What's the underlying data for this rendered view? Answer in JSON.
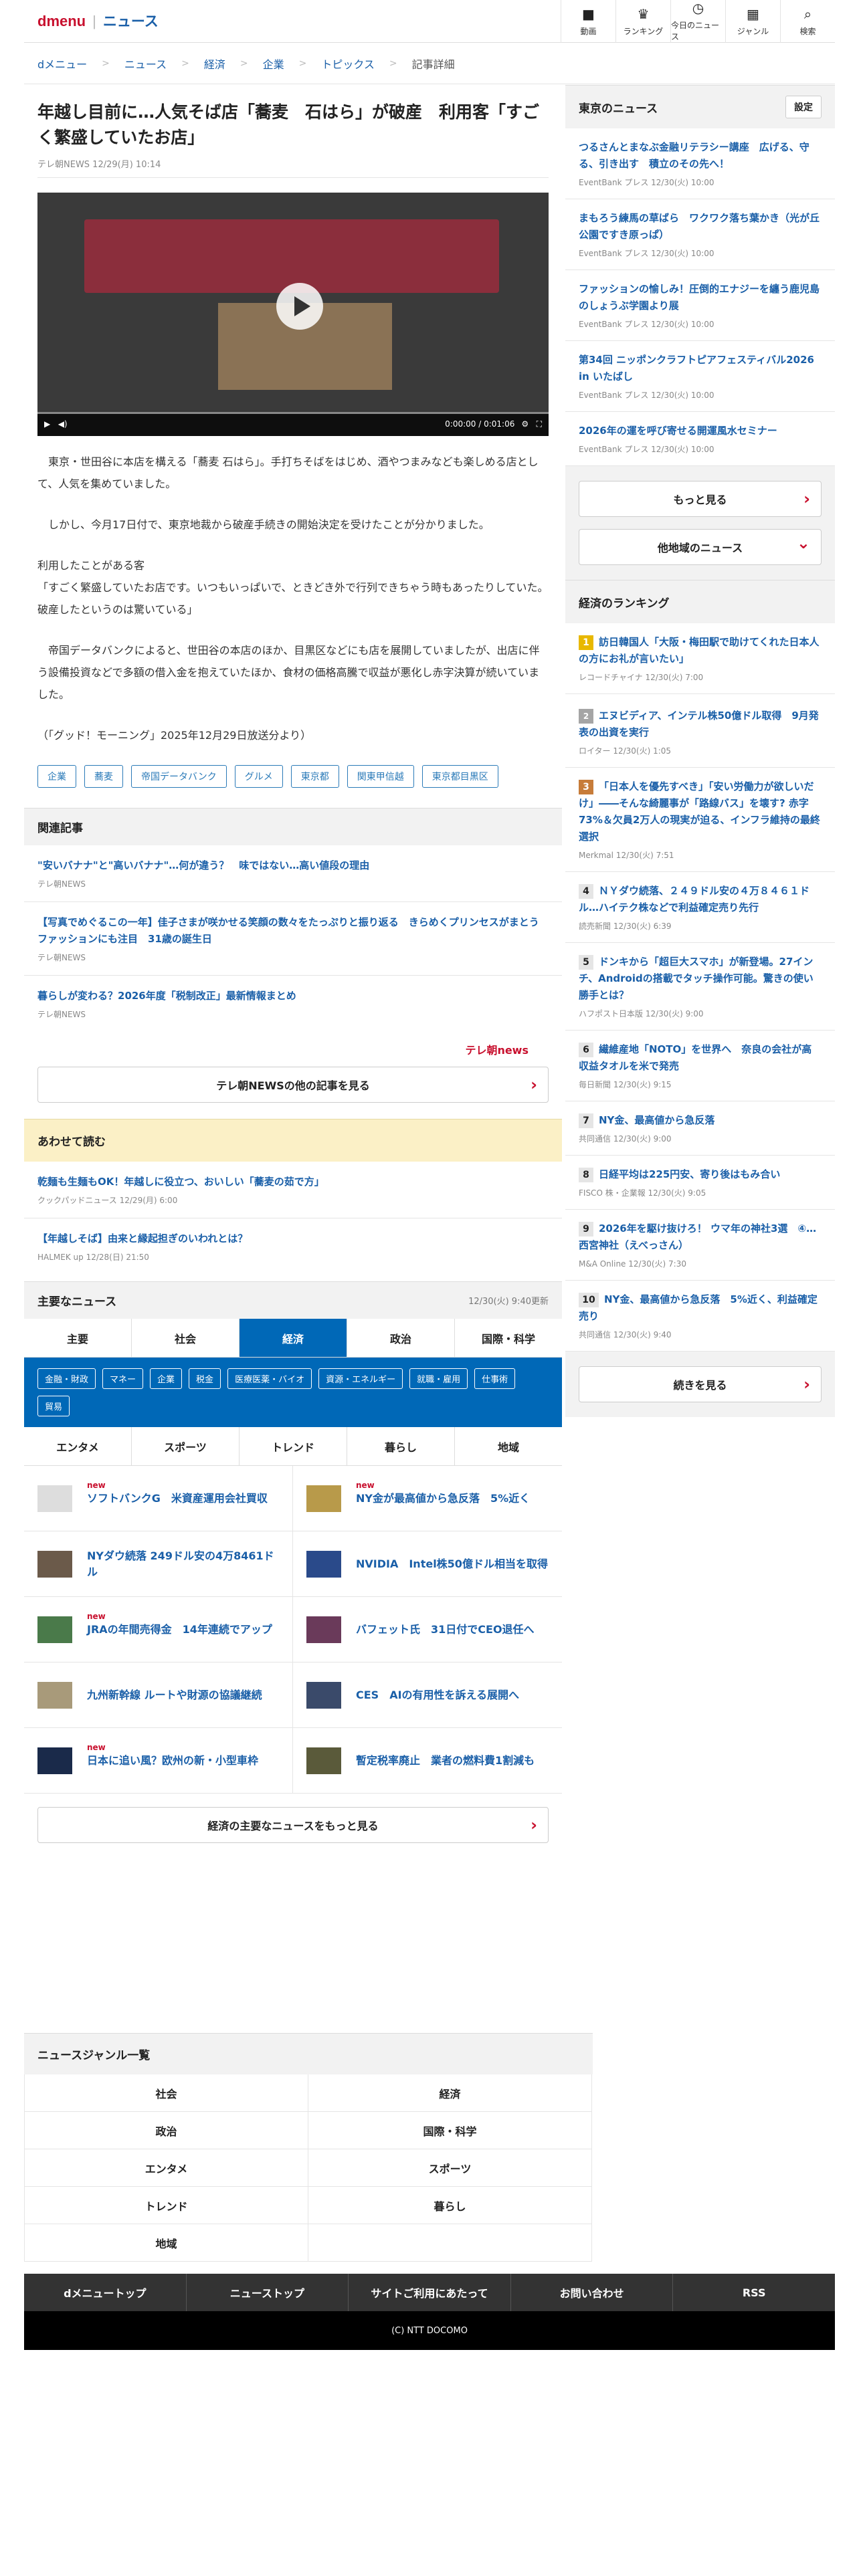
{
  "header": {
    "brand": "dmenu",
    "sep": "|",
    "service": "ニュース",
    "nav": [
      {
        "label": "動画",
        "icon": "■"
      },
      {
        "label": "ランキング",
        "icon": "♛"
      },
      {
        "label": "今日のニュース",
        "icon": "◷"
      },
      {
        "label": "ジャンル",
        "icon": "▦"
      },
      {
        "label": "検索",
        "icon": "⌕"
      }
    ]
  },
  "breadcrumb": [
    "dメニュー",
    "ニュース",
    "経済",
    "企業",
    "トピックス",
    "記事詳細"
  ],
  "article": {
    "title": "年越し目前に…人気そば店「蕎麦　石はら」が破産　利用客「すごく繁盛していたお店」",
    "meta": "テレ朝NEWS 12/29(月) 10:14",
    "video_time": "0:00:00 / 0:01:06",
    "paragraphs": [
      "　東京・世田谷に本店を構える「蕎麦 石はら」。手打ちそばをはじめ、酒やつまみなども楽しめる店として、人気を集めていました。",
      "　しかし、今月17日付で、東京地裁から破産手続きの開始決定を受けたことが分かりました。",
      "利用したことがある客\n「すごく繁盛していたお店です。いつもいっぱいで、ときどき外で行列できちゃう時もあったりしていた。破産したというのは驚いている」",
      "　帝国データバンクによると、世田谷の本店のほか、目黒区などにも店を展開していましたが、出店に伴う設備投資などで多額の借入金を抱えていたほか、食材の価格高騰で収益が悪化し赤字決算が続いていました。",
      "（「グッド！モーニング」2025年12月29日放送分より）"
    ],
    "tags": [
      "企業",
      "蕎麦",
      "帝国データバンク",
      "グルメ",
      "東京都",
      "関東甲信越",
      "東京都目黒区"
    ]
  },
  "related": {
    "heading": "関連記事",
    "items": [
      {
        "title": "\"安いバナナ\"と\"高いバナナ\"…何が違う？　味ではない…高い値段の理由",
        "source": "テレ朝NEWS"
      },
      {
        "title": "【写真でめぐるこの一年】佳子さまが咲かせる笑顔の数々をたっぷりと振り返る　きらめくプリンセスがまとうファッションにも注目　31歳の誕生日",
        "source": "テレ朝NEWS"
      },
      {
        "title": "暮らしが変わる？2026年度「税制改正」最新情報まとめ",
        "source": "テレ朝NEWS"
      }
    ],
    "logo": "テレ朝news",
    "more": "テレ朝NEWSの他の記事を見る"
  },
  "also": {
    "heading": "あわせて読む",
    "items": [
      {
        "title": "乾麺も生麺もOK！年越しに役立つ、おいしい「蕎麦の茹で方」",
        "source": "クックパッドニュース 12/29(月) 6:00"
      },
      {
        "title": "【年越しそば】由来と縁起担ぎのいわれとは？",
        "source": "HALMEK up 12/28(日) 21:50"
      }
    ]
  },
  "main_news": {
    "heading": "主要なニュース",
    "updated": "12/30(火) 9:40更新",
    "tabs": [
      "主要",
      "社会",
      "経済",
      "政治",
      "国際・科学"
    ],
    "active_tab": "経済",
    "subtags": [
      "金融・財政",
      "マネー",
      "企業",
      "税金",
      "医療医薬・バイオ",
      "資源・エネルギー",
      "就職・雇用",
      "仕事術",
      "貿易"
    ],
    "tabs2": [
      "エンタメ",
      "スポーツ",
      "トレンド",
      "暮らし",
      "地域"
    ],
    "items": [
      {
        "title": "ソフトバンクG　米資産運用会社買収",
        "new": "new"
      },
      {
        "title": "NY金が最高値から急反落　5%近く",
        "new": "new"
      },
      {
        "title": "NYダウ続落 249ドル安の4万8461ドル",
        "new": ""
      },
      {
        "title": "NVIDIA　Intel株50億ドル相当を取得",
        "new": ""
      },
      {
        "title": "JRAの年間売得金　14年連続でアップ",
        "new": "new"
      },
      {
        "title": "バフェット氏　31日付でCEO退任へ",
        "new": ""
      },
      {
        "title": "九州新幹線 ルートや財源の協議継続",
        "new": ""
      },
      {
        "title": "CES　AIの有用性を訴える展開へ",
        "new": ""
      },
      {
        "title": "日本に追い風？欧州の新・小型車枠",
        "new": "new"
      },
      {
        "title": "暫定税率廃止　業者の燃料費1割減も",
        "new": ""
      }
    ],
    "more": "経済の主要なニュースをもっと見る"
  },
  "side_tokyo": {
    "heading": "東京のニュース",
    "setting": "設定",
    "items": [
      {
        "title": "つるさんとまなぶ金融リテラシー講座　広げる、守る、引き出す　積立のその先へ！",
        "source": "EventBank プレス 12/30(火) 10:00"
      },
      {
        "title": "まもろう練馬の草ばら　ワクワク落ち葉かき（光が丘公園ですき原っぱ）",
        "source": "EventBank プレス 12/30(火) 10:00"
      },
      {
        "title": "ファッションの愉しみ！圧倒的エナジーを纏う鹿児島のしょうぶ学園より展",
        "source": "EventBank プレス 12/30(火) 10:00"
      },
      {
        "title": "第34回 ニッポンクラフトピアフェスティバル2026 in いたばし",
        "source": "EventBank プレス 12/30(火) 10:00"
      },
      {
        "title": "2026年の運を呼び寄せる開運風水セミナー",
        "source": "EventBank プレス 12/30(火) 10:00"
      }
    ],
    "more": "もっと見る",
    "other": "他地域のニュース"
  },
  "side_rank": {
    "heading": "経済のランキング",
    "items": [
      {
        "n": "1",
        "title": "訪日韓国人「大阪・梅田駅で助けてくれた日本人の方にお礼が言いたい」",
        "source": "レコードチャイナ 12/30(火) 7:00"
      },
      {
        "n": "2",
        "title": "エヌビディア、インテル株50億ドル取得　9月発表の出資を実行",
        "source": "ロイター 12/30(火) 1:05"
      },
      {
        "n": "3",
        "title": "「日本人を優先すべき」「安い労働力が欲しいだけ」――そんな綺麗事が「路線バス」を壊す? 赤字73%＆欠員2万人の現実が迫る、インフラ維持の最終選択",
        "source": "Merkmal 12/30(火) 7:51"
      },
      {
        "n": "4",
        "title": "ＮＹダウ続落、２４９ドル安の４万８４６１ドル…ハイテク株などで利益確定売り先行",
        "source": "読売新聞 12/30(火) 6:39"
      },
      {
        "n": "5",
        "title": "ドンキから「超巨大スマホ」が新登場。27インチ、Androidの搭載でタッチ操作可能。驚きの使い勝手とは？",
        "source": "ハフポスト日本版 12/30(火) 9:00"
      },
      {
        "n": "6",
        "title": "繊維産地「NOTO」を世界へ　奈良の会社が高収益タオルを米で発売",
        "source": "毎日新聞 12/30(火) 9:15"
      },
      {
        "n": "7",
        "title": "NY金、最高値から急反落",
        "source": "共同通信 12/30(火) 9:00"
      },
      {
        "n": "8",
        "title": "日経平均は225円安、寄り後はもみ合い",
        "source": "FISCO 株・企業報 12/30(火) 9:05"
      },
      {
        "n": "9",
        "title": "2026年を駆け抜けろ！ ウマ年の神社3選　④…西宮神社（えべっさん）",
        "source": "M&A Online 12/30(火) 7:30"
      },
      {
        "n": "10",
        "title": "NY金、最高値から急反落　5%近く、利益確定売り",
        "source": "共同通信 12/30(火) 9:40"
      }
    ],
    "more": "続きを見る"
  },
  "genre": {
    "heading": "ニュースジャンル一覧",
    "items": [
      "社会",
      "経済",
      "政治",
      "国際・科学",
      "エンタメ",
      "スポーツ",
      "トレンド",
      "暮らし",
      "地域",
      ""
    ]
  },
  "footer": {
    "nav": [
      "dメニュートップ",
      "ニューストップ",
      "サイトご利用にあたって",
      "お問い合わせ",
      "RSS"
    ],
    "copy": "(C) NTT DOCOMO"
  },
  "colors": {
    "brand": "#c8102e",
    "link": "#1a5fa8",
    "tab_active": "#0068b7"
  }
}
